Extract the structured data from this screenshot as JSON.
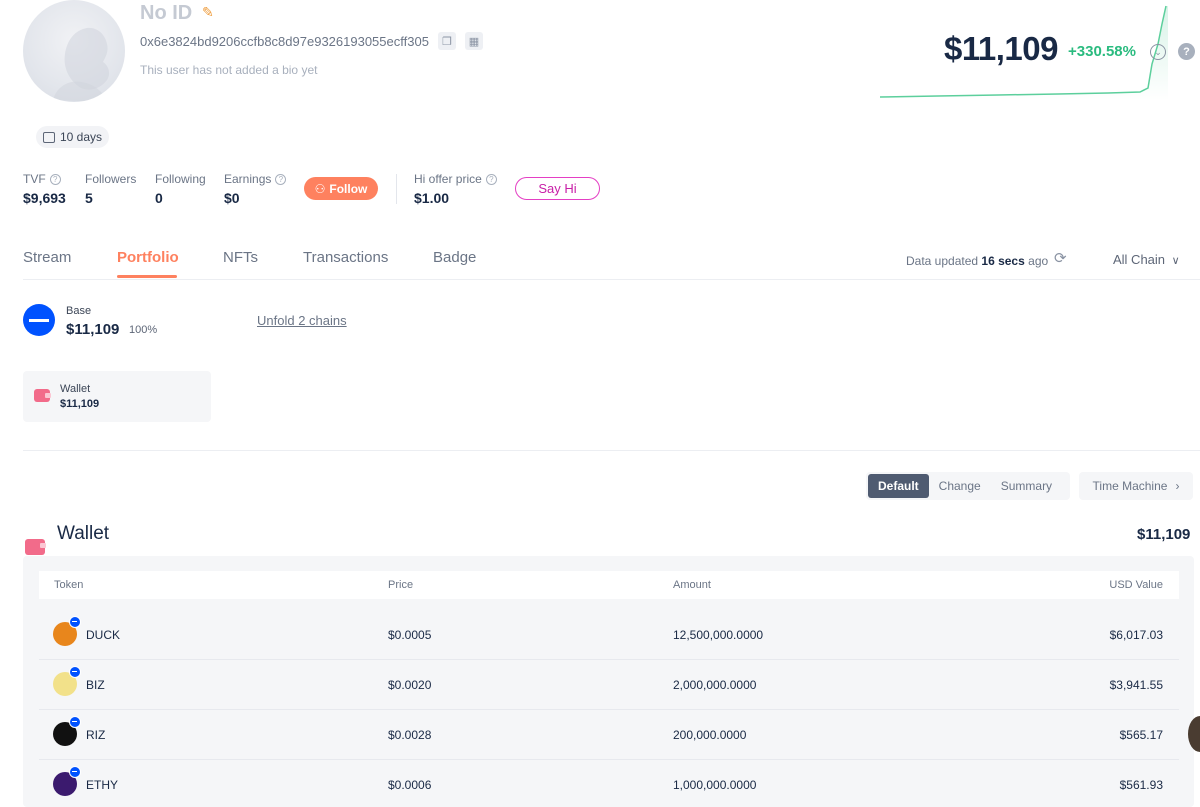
{
  "profile": {
    "name": "No ID",
    "address": "0x6e3824bd9206ccfb8c8d97e9326193055ecff305",
    "bio": "This user has not added a bio yet",
    "age_badge": "10 days",
    "net_worth": "$11,109",
    "change_pct": "+330.58%"
  },
  "stats": {
    "tvf_label": "TVF",
    "tvf_value": "$9,693",
    "followers_label": "Followers",
    "followers_value": "5",
    "following_label": "Following",
    "following_value": "0",
    "earnings_label": "Earnings",
    "earnings_value": "$0",
    "follow_label": "Follow",
    "offer_label": "Hi offer price",
    "offer_value": "$1.00",
    "say_hi_label": "Say Hi"
  },
  "tabs": [
    {
      "label": "Stream"
    },
    {
      "label": "Portfolio",
      "active": true
    },
    {
      "label": "NFTs"
    },
    {
      "label": "Transactions"
    },
    {
      "label": "Badge"
    }
  ],
  "update_status": {
    "prefix": "Data updated",
    "time": "16 secs",
    "suffix": "ago"
  },
  "chain_filter": "All Chain",
  "chain_summary": {
    "name": "Base",
    "value": "$11,109",
    "percent": "100%",
    "unfold_label": "Unfold 2 chains"
  },
  "wallet_card": {
    "label": "Wallet",
    "value": "$11,109"
  },
  "view_modes": [
    {
      "label": "Default",
      "active": true
    },
    {
      "label": "Change"
    },
    {
      "label": "Summary"
    }
  ],
  "time_machine_label": "Time Machine",
  "wallet_section": {
    "title": "Wallet",
    "total": "$11,109",
    "columns": [
      "Token",
      "Price",
      "Amount",
      "USD Value"
    ],
    "rows": [
      {
        "token": "DUCK",
        "price": "$0.0005",
        "amount": "12,500,000.0000",
        "usd": "$6,017.03",
        "logo_color": "#e8861c"
      },
      {
        "token": "BIZ",
        "price": "$0.0020",
        "amount": "2,000,000.0000",
        "usd": "$3,941.55",
        "logo_color": "#f2e18a"
      },
      {
        "token": "RIZ",
        "price": "$0.0028",
        "amount": "200,000.0000",
        "usd": "$565.17",
        "logo_color": "#111111"
      },
      {
        "token": "ETHY",
        "price": "$0.0006",
        "amount": "1,000,000.0000",
        "usd": "$561.93",
        "logo_color": "#3b1a6e"
      }
    ]
  },
  "colors": {
    "accent": "#fe815f",
    "positive": "#2abb7f",
    "base_blue": "#0052ff",
    "say_hi": "#c81fa7"
  }
}
